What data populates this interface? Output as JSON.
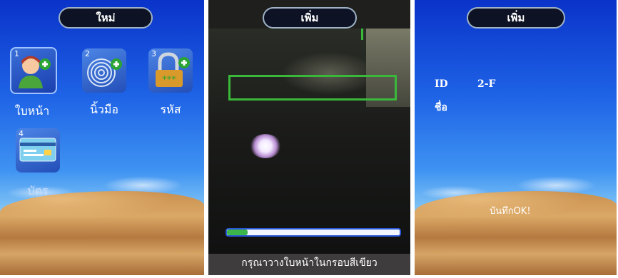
{
  "panels": {
    "new_menu": {
      "title": "ใหม่",
      "items": [
        {
          "number": "1",
          "label": "ใบหน้า",
          "icon": "face-add-icon"
        },
        {
          "number": "2",
          "label": "นิ้วมือ",
          "icon": "fingerprint-add-icon"
        },
        {
          "number": "3",
          "label": "รหัส",
          "icon": "password-add-icon"
        },
        {
          "number": "4",
          "label": "บัตร",
          "icon": "card-icon"
        }
      ]
    },
    "face_capture": {
      "title": "เพิ่ม",
      "progress": 0.12,
      "instruction": "กรุณาวางใบหน้าในกรอบสีเขียว"
    },
    "enroll_result": {
      "title": "เพิ่ม",
      "id_label": "ID",
      "id_value": "2-F",
      "name_label": "ชื่อ",
      "status": "บันทึกOK!"
    }
  },
  "colors": {
    "title_bg": "#0d1324",
    "frame_green": "#3ab83a",
    "progress_fill": "#3cb54a",
    "progress_border": "#2a56d8"
  }
}
